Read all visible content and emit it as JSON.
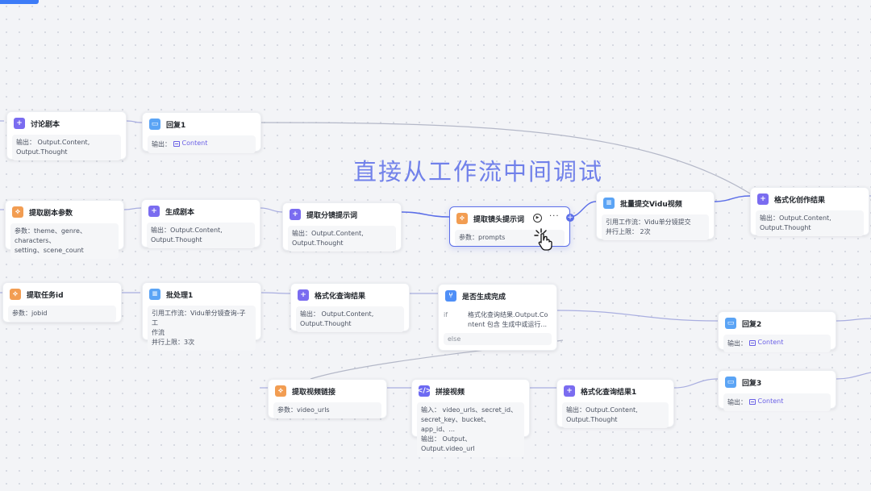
{
  "overlay": {
    "caption": "直接从工作流中间调试"
  },
  "nodes": {
    "discuss_script": {
      "title": "讨论剧本",
      "line1": "输出：  Output.Content,",
      "line2": "Output.Thought"
    },
    "reply1": {
      "title": "回复1",
      "label": "输出：",
      "tag": "Content"
    },
    "extract_script_params": {
      "title": "提取剧本参数",
      "line1": "参数：theme、genre、characters、",
      "line2": "setting、scene_count"
    },
    "generate_script": {
      "title": "生成剧本",
      "line1": "输出：Output.Content,",
      "line2": "Output.Thought"
    },
    "extract_storyboard_prompt": {
      "title": "提取分镜提示词",
      "line1": "输出：Output.Content,",
      "line2": "Output.Thought"
    },
    "extract_shot_prompt": {
      "title": "提取镜头提示词",
      "line1": "参数：prompts"
    },
    "batch_submit_vidu": {
      "title": "批量提交Vidu视频",
      "line1": "引用工作流：Vidu单分镜提交",
      "line2": "并行上限：  2次"
    },
    "format_creation_result": {
      "title": "格式化创作结果",
      "line1": "输出：Output.Content,",
      "line2": "Output.Thought"
    },
    "extract_task_id": {
      "title": "提取任务id",
      "line1": "参数：jobid"
    },
    "batch1": {
      "title": "批处理1",
      "line1": "引用工作流：Vidu单分镜查询-子工",
      "line2": "作流",
      "line3": "并行上限：3次"
    },
    "format_query_result": {
      "title": "格式化查询结果",
      "line1": "输出：  Output.Content,",
      "line2": "Output.Thought"
    },
    "is_generated": {
      "title": "是否生成完成",
      "if_label": "if",
      "if_text1": "格式化查询结果.Output.Co",
      "if_text2": "ntent 包含 生成中或运行...",
      "else_label": "else"
    },
    "reply2": {
      "title": "回复2",
      "label": "输出：",
      "tag": "Content"
    },
    "extract_video_link": {
      "title": "提取视频链接",
      "line1": "参数：video_urls"
    },
    "concat_video": {
      "title": "拼接视频",
      "line1": "输入：  video_urls、secret_id、",
      "line2": "secret_key、bucket、app_id、...",
      "line3": "输出：  Output、Output.video_url"
    },
    "format_query_result1": {
      "title": "格式化查询结果1",
      "line1": "输出：Output.Content,",
      "line2": "Output.Thought"
    },
    "reply3": {
      "title": "回复3",
      "label": "输出：",
      "tag": "Content"
    }
  },
  "controls": {
    "add_symbol": "+",
    "more_symbol": "···",
    "run_symbol": "▶"
  },
  "colors": {
    "accent": "#5b6ee8",
    "llm_icon": "#7a6cf0",
    "param_icon": "#f29d52",
    "reply_icon": "#5ba4f5",
    "edge": "#a9aee0"
  },
  "icons": {
    "llm": "sparkle-plus-icon",
    "param": "parameter-extract-icon",
    "reply": "reply-bubble-icon",
    "batch": "batch-stack-icon",
    "condition": "branch-icon",
    "code": "code-icon",
    "cursor": "hand-pointer-icon"
  }
}
